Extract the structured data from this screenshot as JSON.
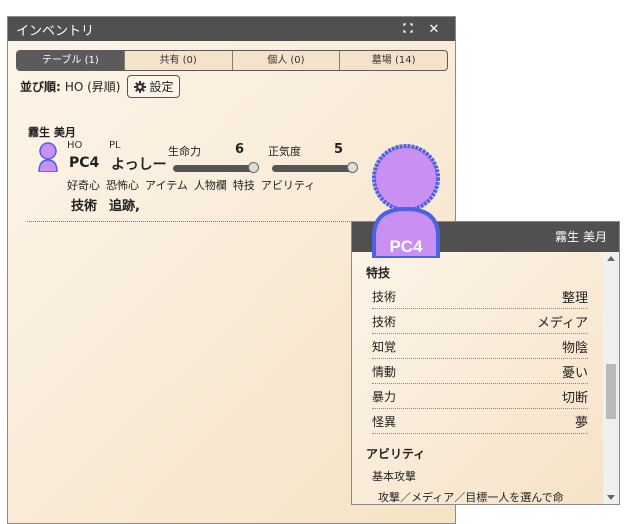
{
  "window": {
    "title": "インベントリ",
    "maximize_icon": "maximize-icon",
    "close_icon": "close-icon"
  },
  "tabs": [
    {
      "label": "テーブル (1)",
      "active": true
    },
    {
      "label": "共有 (0)",
      "active": false
    },
    {
      "label": "個人 (0)",
      "active": false
    },
    {
      "label": "墓場 (14)",
      "active": false
    }
  ],
  "sort": {
    "label": "並び順:",
    "value": "HO (昇順)",
    "settings_label": "設定"
  },
  "character": {
    "name": "霧生 美月",
    "ho_label": "HO",
    "pl_label": "PL",
    "ho": "PC4",
    "pl": "よっしー",
    "hp_label": "生命力",
    "hp": "6",
    "hp_fraction": 1.0,
    "sanity_label": "正気度",
    "sanity": "5",
    "sanity_fraction": 1.0,
    "tags": [
      "好奇心",
      "恐怖心",
      "アイテム",
      "人物欄",
      "特技",
      "アビリティ"
    ],
    "curiosity": "技術",
    "fear": "追跡,"
  },
  "avatar": {
    "label": "PC4",
    "color": "#c98ff2",
    "border": "#4a63e0"
  },
  "popup": {
    "name": "霧生 美月",
    "skills_title": "特技",
    "skills": [
      {
        "category": "技術",
        "name": "整理"
      },
      {
        "category": "技術",
        "name": "メディア"
      },
      {
        "category": "知覚",
        "name": "物陰"
      },
      {
        "category": "情動",
        "name": "憂い"
      },
      {
        "category": "暴力",
        "name": "切断"
      },
      {
        "category": "怪異",
        "name": "夢"
      }
    ],
    "abilities_title": "アビリティ",
    "ability_name": "基本攻撃",
    "ability_desc": "攻撃／メディア／目標一人を選んで命"
  }
}
